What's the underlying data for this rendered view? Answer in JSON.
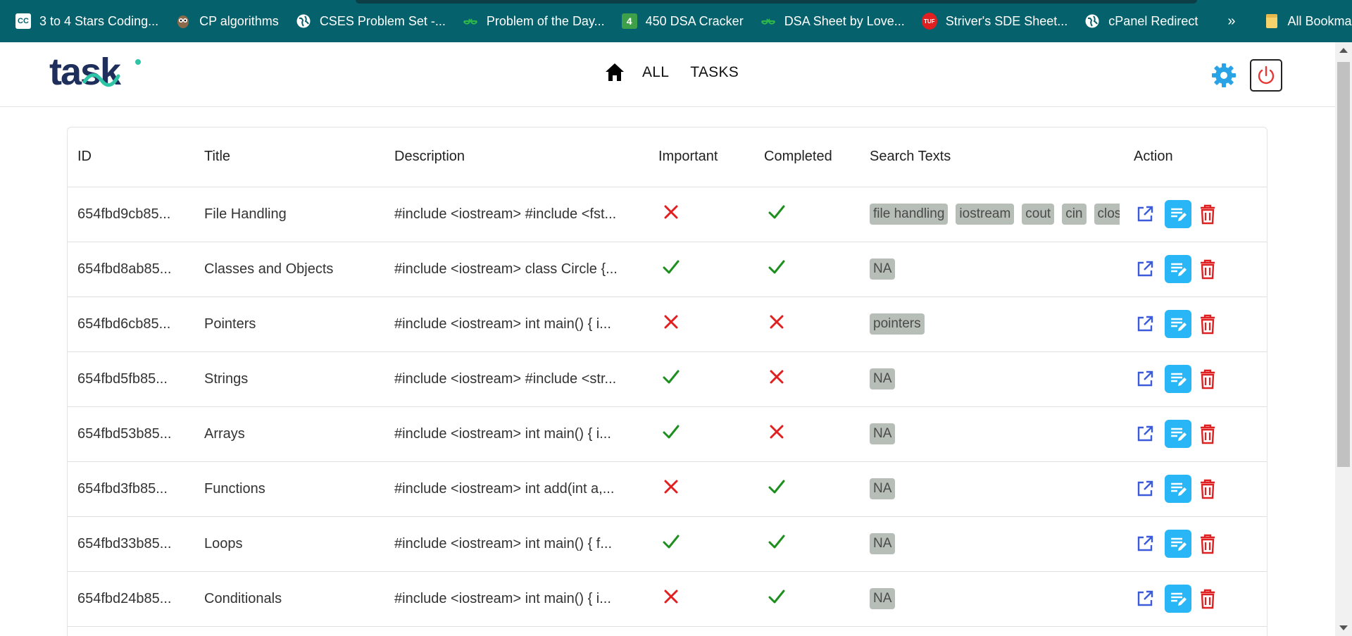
{
  "bookmarks": {
    "items": [
      {
        "label": "3 to 4 Stars Coding...",
        "icon": "cc-icon"
      },
      {
        "label": "CP algorithms",
        "icon": "owl-icon"
      },
      {
        "label": "CSES Problem Set -...",
        "icon": "globe-icon"
      },
      {
        "label": "Problem of the Day...",
        "icon": "gfg-icon"
      },
      {
        "label": "450 DSA Cracker",
        "icon": "four-icon"
      },
      {
        "label": "DSA Sheet by Love...",
        "icon": "gfg-icon"
      },
      {
        "label": "Striver's SDE Sheet...",
        "icon": "tuf-icon"
      },
      {
        "label": "cPanel Redirect",
        "icon": "globe-icon"
      }
    ],
    "more": "»",
    "all_bookmarks": "All Bookmarks",
    "cc_icon_text": "CC",
    "four_icon_text": "4",
    "tuf_icon_text": "TUF"
  },
  "navbar": {
    "logo_text": "task",
    "links": [
      "ALL",
      "TASKS"
    ],
    "accent_color": "#29a3e6",
    "power_color": "#e53935"
  },
  "table": {
    "headers": [
      "ID",
      "Title",
      "Description",
      "Important",
      "Completed",
      "Search Texts",
      "Action"
    ],
    "rows": [
      {
        "id": "654fbd9cb85...",
        "title": "File Handling",
        "description": "#include <iostream> #include <fst...",
        "important": false,
        "completed": true,
        "tags": [
          "file handling",
          "iostream",
          "cout",
          "cin",
          "clos"
        ]
      },
      {
        "id": "654fbd8ab85...",
        "title": "Classes and Objects",
        "description": "#include <iostream> class Circle {...",
        "important": true,
        "completed": true,
        "tags": [
          "NA"
        ]
      },
      {
        "id": "654fbd6cb85...",
        "title": "Pointers",
        "description": "#include <iostream> int main() { i...",
        "important": false,
        "completed": false,
        "tags": [
          "pointers"
        ]
      },
      {
        "id": "654fbd5fb85...",
        "title": "Strings",
        "description": "#include <iostream> #include <str...",
        "important": true,
        "completed": false,
        "tags": [
          "NA"
        ]
      },
      {
        "id": "654fbd53b85...",
        "title": "Arrays",
        "description": "#include <iostream> int main() { i...",
        "important": true,
        "completed": false,
        "tags": [
          "NA"
        ]
      },
      {
        "id": "654fbd3fb85...",
        "title": "Functions",
        "description": "#include <iostream> int add(int a,...",
        "important": false,
        "completed": true,
        "tags": [
          "NA"
        ]
      },
      {
        "id": "654fbd33b85...",
        "title": "Loops",
        "description": "#include <iostream> int main() { f...",
        "important": true,
        "completed": true,
        "tags": [
          "NA"
        ]
      },
      {
        "id": "654fbd24b85...",
        "title": "Conditionals",
        "description": "#include <iostream> int main() { i...",
        "important": false,
        "completed": true,
        "tags": [
          "NA"
        ]
      }
    ],
    "colors": {
      "check": "#1e8f1e",
      "cross": "#e02020",
      "tag_bg": "#b7bdb7",
      "open_icon": "#3b5bdb",
      "edit_bg": "#29b6f6",
      "delete_icon": "#e02020"
    }
  }
}
